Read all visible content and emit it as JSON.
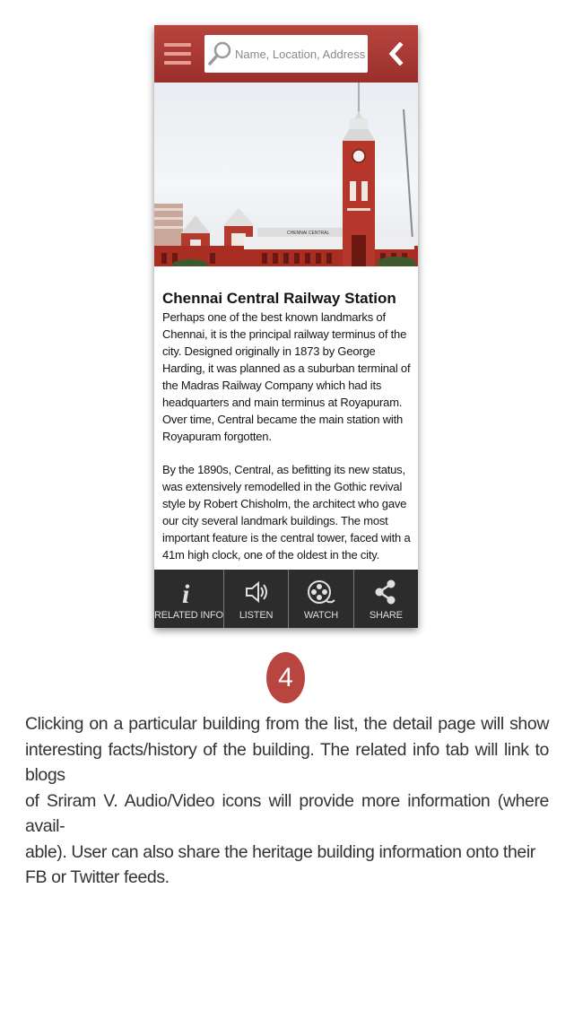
{
  "search": {
    "placeholder": "Name, Location, Address"
  },
  "header": {
    "menu_icon": "hamburger-menu-icon",
    "back_icon": "chevron-left-icon",
    "color": "#a8362f"
  },
  "detail": {
    "title": "Chennai Central Railway Station",
    "paragraphs": [
      "Perhaps one of the best known landmarks of Chennai, it is the principal railway terminus of the city. Designed originally in 1873 by George Harding, it was planned as a suburban terminal of the Madras Railway Company which had its headquarters and main terminus at Royapuram. Over time, Central became the main station with Royapuram forgotten.",
      "By the 1890s, Central, as befitting its new status, was extensively remodelled in the Gothic revival style by Robert Chisholm, the architect who gave our city several landmark buildings. The most important feature is the central tower, faced with a 41m high clock, one of the oldest in the city."
    ],
    "hero_sign": "CHENNAI CENTRAL"
  },
  "tabs": [
    {
      "label": "RELATED INFO",
      "icon": "info-icon"
    },
    {
      "label": "LISTEN",
      "icon": "speaker-icon"
    },
    {
      "label": "WATCH",
      "icon": "film-reel-icon"
    },
    {
      "label": "SHARE",
      "icon": "share-icon"
    }
  ],
  "step": {
    "number": "4",
    "color": "#b8453f"
  },
  "description": {
    "lines": [
      "Clicking on a particular building from the list, the detail page will show",
      "interesting facts/history of the building. The related info tab will link to blogs",
      "of Sriram V. Audio/Video icons will provide more information (where avail-",
      "able). User can also share the heritage building information onto their",
      "FB or Twitter feeds."
    ]
  }
}
